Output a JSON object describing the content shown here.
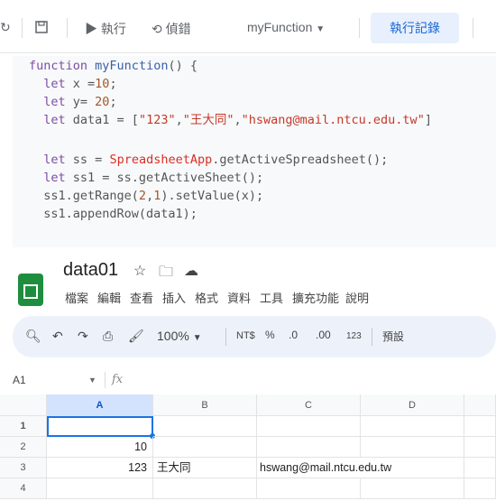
{
  "editor": {
    "toolbar": {
      "run_label": "執行",
      "debug_label": "偵錯",
      "function_select": "myFunction",
      "exec_log_label": "執行記錄"
    },
    "code_lines": [
      "function myFunction() {",
      "  let x =10;",
      "  let y= 20;",
      "  let data1 = [\"123\",\"王大同\",\"hswang@mail.ntcu.edu.tw\"]",
      "",
      "  let ss = SpreadsheetApp.getActiveSpreadsheet();",
      "  let ss1 = ss.getActiveSheet();",
      "  ss1.getRange(2,1).setValue(x);",
      "  ss1.appendRow(data1);"
    ]
  },
  "sheets": {
    "title": "data01",
    "menu": [
      "檔案",
      "編輯",
      "查看",
      "插入",
      "格式",
      "資料",
      "工具",
      "擴充功能",
      "說明"
    ],
    "toolbar": {
      "zoom": "100%",
      "currency": "NT$",
      "percent": "%",
      "dec_decrease": ".0",
      "dec_increase": ".00",
      "number_format": "123",
      "font_default": "預設"
    },
    "formula_bar": {
      "cell_ref": "A1",
      "fx": "fx"
    },
    "grid": {
      "columns": [
        "A",
        "B",
        "C",
        "D"
      ],
      "rows": [
        {
          "num": "1",
          "cells": [
            "",
            "",
            "",
            ""
          ]
        },
        {
          "num": "2",
          "cells": [
            "10",
            "",
            "",
            ""
          ]
        },
        {
          "num": "3",
          "cells": [
            "123",
            "王大同",
            "hswang@mail.ntcu.edu.tw",
            ""
          ]
        },
        {
          "num": "4",
          "cells": [
            "",
            "",
            "",
            ""
          ]
        }
      ]
    }
  }
}
